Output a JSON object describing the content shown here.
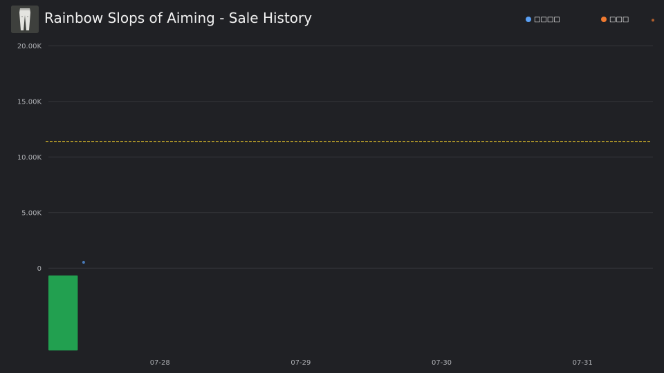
{
  "header": {
    "title": "Rainbow Slops of Aiming - Sale History",
    "thumbnail_icon": "pants-icon"
  },
  "legend": {
    "items": [
      {
        "label": "□□□□",
        "color": "#5aa0f5"
      },
      {
        "label": "□□□",
        "color": "#f07a30"
      }
    ]
  },
  "chart_data": {
    "type": "bar",
    "title": "Rainbow Slops of Aiming - Sale History",
    "xlabel": "",
    "ylabel": "",
    "x_ticks": [
      "07-28",
      "07-29",
      "07-30",
      "07-31"
    ],
    "y_ticks": [
      "0",
      "5.00K",
      "10.00K",
      "15.00K",
      "20.00K"
    ],
    "ylim": [
      -7500,
      22500
    ],
    "xlim": [
      "07-27 05:00",
      "07-31 12:00"
    ],
    "grid": true,
    "legend_position": "top-right",
    "series": [
      {
        "kind": "bar",
        "color": "#22a050",
        "points": [
          {
            "x_start": "07-27 05:00",
            "x_end": "07-27 10:00",
            "y_from": -650,
            "y_to": -7400
          }
        ]
      },
      {
        "kind": "scatter",
        "color": "#5aa0f5",
        "points": [
          {
            "x": "07-27 11:00",
            "y": 520
          }
        ]
      },
      {
        "kind": "scatter",
        "color": "#f07a30",
        "points": [
          {
            "x": "07-31 12:00",
            "y": 22300
          }
        ]
      }
    ],
    "reference_line": {
      "y": 11400,
      "color": "#e6c52a",
      "style": "dashed"
    }
  }
}
